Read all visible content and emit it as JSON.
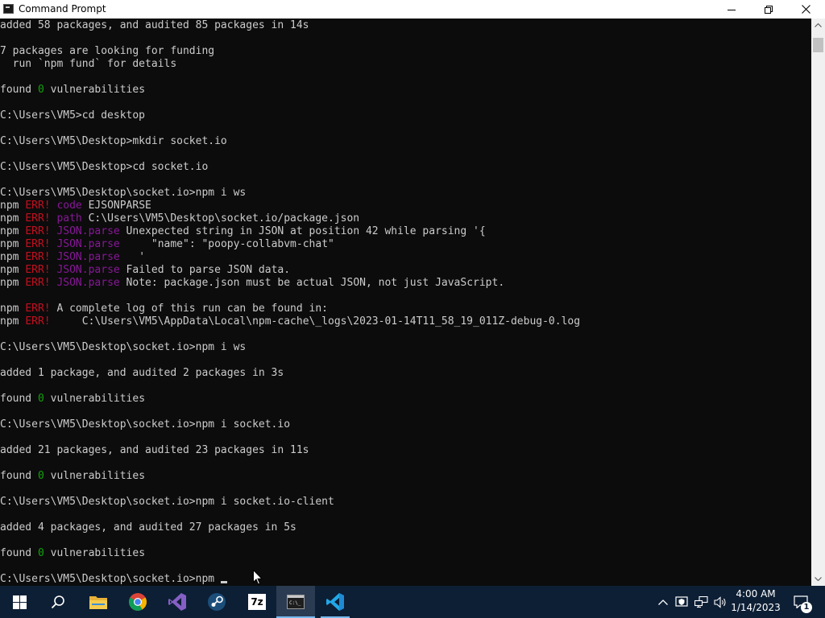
{
  "window": {
    "title": "Command Prompt",
    "icons": {
      "app": "cmd-icon",
      "minimize": "minimize-icon",
      "maximize": "restore-icon",
      "close": "close-icon"
    }
  },
  "console": {
    "lines": [
      [
        {
          "t": "added 58 packages, and audited 85 packages in 14s"
        }
      ],
      [
        {
          "t": ""
        }
      ],
      [
        {
          "t": "7 packages are looking for funding"
        }
      ],
      [
        {
          "t": "  run `npm fund` for details"
        }
      ],
      [
        {
          "t": ""
        }
      ],
      [
        {
          "t": "found "
        },
        {
          "t": "0",
          "c": "grn"
        },
        {
          "t": " vulnerabilities"
        }
      ],
      [
        {
          "t": ""
        }
      ],
      [
        {
          "t": "C:\\Users\\VM5>cd desktop"
        }
      ],
      [
        {
          "t": ""
        }
      ],
      [
        {
          "t": "C:\\Users\\VM5\\Desktop>mkdir socket.io"
        }
      ],
      [
        {
          "t": ""
        }
      ],
      [
        {
          "t": "C:\\Users\\VM5\\Desktop>cd socket.io"
        }
      ],
      [
        {
          "t": ""
        }
      ],
      [
        {
          "t": "C:\\Users\\VM5\\Desktop\\socket.io>npm i ws"
        }
      ],
      [
        {
          "t": "npm "
        },
        {
          "t": "ERR!",
          "c": "red"
        },
        {
          "t": " "
        },
        {
          "t": "code",
          "c": "mag"
        },
        {
          "t": " EJSONPARSE"
        }
      ],
      [
        {
          "t": "npm "
        },
        {
          "t": "ERR!",
          "c": "red"
        },
        {
          "t": " "
        },
        {
          "t": "path",
          "c": "mag"
        },
        {
          "t": " C:\\Users\\VM5\\Desktop\\socket.io/package.json"
        }
      ],
      [
        {
          "t": "npm "
        },
        {
          "t": "ERR!",
          "c": "red"
        },
        {
          "t": " "
        },
        {
          "t": "JSON.parse",
          "c": "mag"
        },
        {
          "t": " Unexpected string in JSON at position 42 while parsing '{"
        }
      ],
      [
        {
          "t": "npm "
        },
        {
          "t": "ERR!",
          "c": "red"
        },
        {
          "t": " "
        },
        {
          "t": "JSON.parse",
          "c": "mag"
        },
        {
          "t": "     \"name\": \"poopy-collabvm-chat\""
        }
      ],
      [
        {
          "t": "npm "
        },
        {
          "t": "ERR!",
          "c": "red"
        },
        {
          "t": " "
        },
        {
          "t": "JSON.parse",
          "c": "mag"
        },
        {
          "t": "   '"
        }
      ],
      [
        {
          "t": "npm "
        },
        {
          "t": "ERR!",
          "c": "red"
        },
        {
          "t": " "
        },
        {
          "t": "JSON.parse",
          "c": "mag"
        },
        {
          "t": " Failed to parse JSON data."
        }
      ],
      [
        {
          "t": "npm "
        },
        {
          "t": "ERR!",
          "c": "red"
        },
        {
          "t": " "
        },
        {
          "t": "JSON.parse",
          "c": "mag"
        },
        {
          "t": " Note: package.json must be actual JSON, not just JavaScript."
        }
      ],
      [
        {
          "t": ""
        }
      ],
      [
        {
          "t": "npm "
        },
        {
          "t": "ERR!",
          "c": "red"
        },
        {
          "t": " A complete log of this run can be found in:"
        }
      ],
      [
        {
          "t": "npm "
        },
        {
          "t": "ERR!",
          "c": "red"
        },
        {
          "t": "     C:\\Users\\VM5\\AppData\\Local\\npm-cache\\_logs\\2023-01-14T11_58_19_011Z-debug-0.log"
        }
      ],
      [
        {
          "t": ""
        }
      ],
      [
        {
          "t": "C:\\Users\\VM5\\Desktop\\socket.io>npm i ws"
        }
      ],
      [
        {
          "t": ""
        }
      ],
      [
        {
          "t": "added 1 package, and audited 2 packages in 3s"
        }
      ],
      [
        {
          "t": ""
        }
      ],
      [
        {
          "t": "found "
        },
        {
          "t": "0",
          "c": "grn"
        },
        {
          "t": " vulnerabilities"
        }
      ],
      [
        {
          "t": ""
        }
      ],
      [
        {
          "t": "C:\\Users\\VM5\\Desktop\\socket.io>npm i socket.io"
        }
      ],
      [
        {
          "t": ""
        }
      ],
      [
        {
          "t": "added 21 packages, and audited 23 packages in 11s"
        }
      ],
      [
        {
          "t": ""
        }
      ],
      [
        {
          "t": "found "
        },
        {
          "t": "0",
          "c": "grn"
        },
        {
          "t": " vulnerabilities"
        }
      ],
      [
        {
          "t": ""
        }
      ],
      [
        {
          "t": "C:\\Users\\VM5\\Desktop\\socket.io>npm i socket.io-client"
        }
      ],
      [
        {
          "t": ""
        }
      ],
      [
        {
          "t": "added 4 packages, and audited 27 packages in 5s"
        }
      ],
      [
        {
          "t": ""
        }
      ],
      [
        {
          "t": "found "
        },
        {
          "t": "0",
          "c": "grn"
        },
        {
          "t": " vulnerabilities"
        }
      ],
      [
        {
          "t": ""
        }
      ],
      [
        {
          "t": "C:\\Users\\VM5\\Desktop\\socket.io>npm "
        }
      ]
    ]
  },
  "colors": {
    "console_bg": "#0c0c0c",
    "console_text": "#cccccc",
    "err_red": "#c50f1f",
    "npm_magenta": "#881798",
    "ok_green": "#13a10e",
    "taskbar_bg": "#0d1f35",
    "accent": "#76b9ed"
  },
  "taskbar": {
    "items": [
      {
        "name": "start-button",
        "icon": "windows-logo-icon"
      },
      {
        "name": "search-button",
        "icon": "search-icon"
      },
      {
        "name": "file-explorer",
        "icon": "folder-icon"
      },
      {
        "name": "chrome",
        "icon": "chrome-icon"
      },
      {
        "name": "visual-studio",
        "icon": "visual-studio-icon"
      },
      {
        "name": "steam",
        "icon": "steam-icon"
      },
      {
        "name": "7zip",
        "icon": "7zip-icon",
        "label": "7z"
      },
      {
        "name": "command-prompt",
        "icon": "cmd-icon",
        "active": true
      },
      {
        "name": "vscode",
        "icon": "vscode-icon"
      }
    ],
    "tray": {
      "icons": [
        "chevron-up-icon",
        "security-icon",
        "network-icon",
        "volume-icon"
      ],
      "time": "4:00 AM",
      "date": "1/14/2023",
      "notification_count": "1"
    }
  }
}
